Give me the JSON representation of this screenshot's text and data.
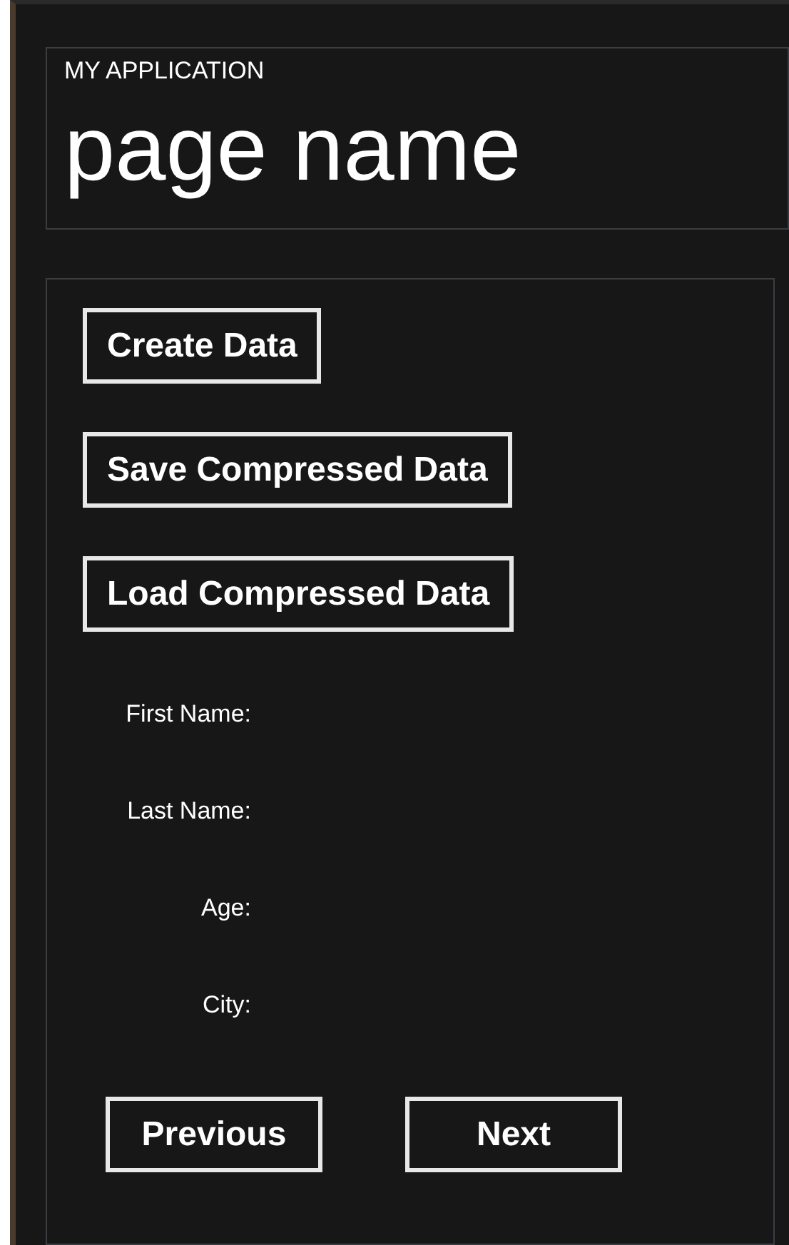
{
  "header": {
    "app_title": "MY APPLICATION",
    "page_title": "page name"
  },
  "actions": [
    "Create Data",
    "Save Compressed Data",
    "Load Compressed Data"
  ],
  "fields": [
    {
      "label": "First Name:"
    },
    {
      "label": "Last Name:"
    },
    {
      "label": "Age:"
    },
    {
      "label": "City:"
    }
  ],
  "navigation": [
    "Previous",
    "Next"
  ]
}
